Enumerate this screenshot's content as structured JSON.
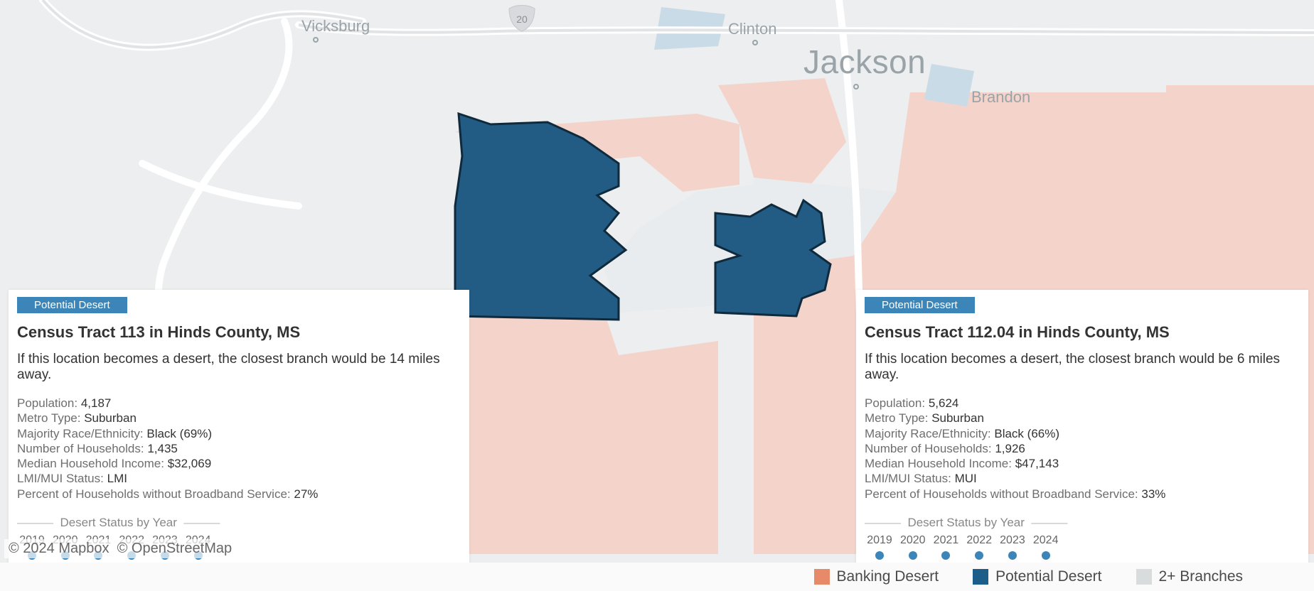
{
  "map": {
    "cities": {
      "jackson": "Jackson",
      "vicksburg": "Vicksburg",
      "clinton": "Clinton",
      "brandon": "Brandon"
    },
    "attribution_mapbox": "© 2024 Mapbox",
    "attribution_osm": "© OpenStreetMap",
    "highway_shield": "20"
  },
  "legend": {
    "banking_desert": "Banking Desert",
    "potential_desert": "Potential Desert",
    "two_plus": "2+ Branches"
  },
  "colors": {
    "banking_desert": "#e68a6a",
    "potential_desert": "#1d5d8a",
    "two_plus": "#d9dcdd",
    "badge": "#3c85b8"
  },
  "card_left": {
    "badge": "Potential Desert",
    "title": "Census Tract 113 in Hinds County, MS",
    "desc": "If this location becomes a desert, the closest branch would be 14 miles away.",
    "pop_label": "Population:",
    "pop_val": "4,187",
    "metro_label": "Metro Type:",
    "metro_val": "Suburban",
    "race_label": "Majority Race/Ethnicity:",
    "race_val": "Black (69%)",
    "hh_label": "Number of Households:",
    "hh_val": "1,435",
    "inc_label": "Median Household Income:",
    "inc_val": "$32,069",
    "lmi_label": "LMI/MUI Status:",
    "lmi_val": "LMI",
    "bb_label": "Percent of Households without Broadband Service:",
    "bb_val": "27%",
    "years_header": "Desert Status by Year",
    "years": [
      "2019",
      "2020",
      "2021",
      "2022",
      "2023",
      "2024"
    ]
  },
  "card_right": {
    "badge": "Potential Desert",
    "title": "Census Tract 112.04 in Hinds County, MS",
    "desc": "If this location becomes a desert, the closest branch would be 6 miles away.",
    "pop_label": "Population:",
    "pop_val": "5,624",
    "metro_label": "Metro Type:",
    "metro_val": "Suburban",
    "race_label": "Majority Race/Ethnicity:",
    "race_val": "Black (66%)",
    "hh_label": "Number of Households:",
    "hh_val": "1,926",
    "inc_label": "Median Household Income:",
    "inc_val": "$47,143",
    "lmi_label": "LMI/MUI Status:",
    "lmi_val": "MUI",
    "bb_label": "Percent of Households without Broadband Service:",
    "bb_val": "33%",
    "years_header": "Desert Status by Year",
    "years": [
      "2019",
      "2020",
      "2021",
      "2022",
      "2023",
      "2024"
    ]
  }
}
